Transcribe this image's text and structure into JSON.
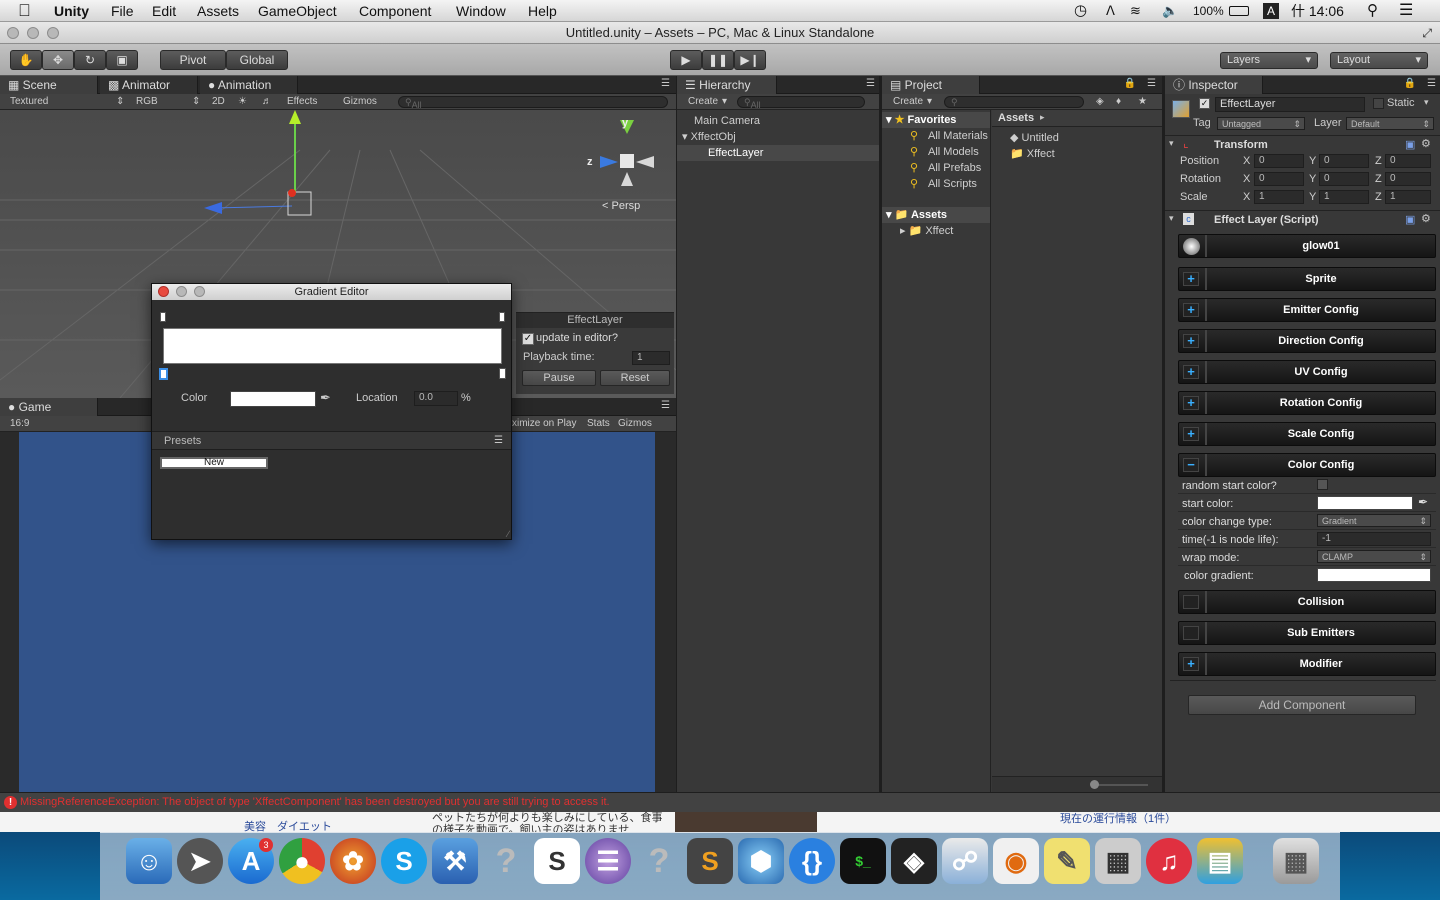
{
  "menubar": {
    "apple": "",
    "items": [
      "Unity",
      "File",
      "Edit",
      "Assets",
      "GameObject",
      "Component",
      "Window",
      "Help"
    ],
    "battery": "100%",
    "input": "A",
    "clock": "什 14:06"
  },
  "window": {
    "title": "Untitled.unity – Assets – PC, Mac & Linux Standalone"
  },
  "toolbar": {
    "pivot": "Pivot",
    "global": "Global",
    "layers": "Layers",
    "layout": "Layout"
  },
  "scene": {
    "tabs": [
      "Scene",
      "Animator",
      "Animation"
    ],
    "shading": "Textured",
    "render": "RGB",
    "mode2d": "2D",
    "effects": "Effects",
    "gizmos": "Gizmos",
    "search": "All",
    "gizmo_y": "y",
    "gizmo_z": "z",
    "persp": "Persp"
  },
  "effect_panel": {
    "title": "EffectLayer",
    "update_label": "update in editor?",
    "playback_label": "Playback time:",
    "playback_value": "1",
    "pause": "Pause",
    "reset": "Reset"
  },
  "gradient_editor": {
    "title": "Gradient Editor",
    "color_label": "Color",
    "location_label": "Location",
    "location_value": "0.0",
    "percent": "%",
    "presets_label": "Presets",
    "new_label": "New"
  },
  "game": {
    "tab": "Game",
    "aspect": "16:9",
    "maximize": "ximize on Play",
    "stats": "Stats",
    "gizmos": "Gizmos"
  },
  "hierarchy": {
    "tab": "Hierarchy",
    "create": "Create",
    "search": "All",
    "items": [
      "Main Camera",
      "XffectObj",
      "EffectLayer"
    ]
  },
  "project": {
    "tab": "Project",
    "create": "Create",
    "favorites": "Favorites",
    "favorite_items": [
      "All Materials",
      "All Models",
      "All Prefabs",
      "All Scripts"
    ],
    "assets": "Assets",
    "asset_tree": [
      "Xffect"
    ],
    "breadcrumb": "Assets",
    "files": [
      "Untitled",
      "Xffect"
    ]
  },
  "inspector": {
    "tab": "Inspector",
    "object_name": "EffectLayer",
    "static": "Static",
    "tag_label": "Tag",
    "tag_value": "Untagged",
    "layer_label": "Layer",
    "layer_value": "Default",
    "transform": "Transform",
    "transform_rows": [
      {
        "label": "Position",
        "x": "0",
        "y": "0",
        "z": "0"
      },
      {
        "label": "Rotation",
        "x": "0",
        "y": "0",
        "z": "0"
      },
      {
        "label": "Scale",
        "x": "1",
        "y": "1",
        "z": "1"
      }
    ],
    "axis_x": "X",
    "axis_y": "Y",
    "axis_z": "Z",
    "script_title": "Effect Layer (Script)",
    "material": "glow01",
    "sections": [
      "Sprite",
      "Emitter Config",
      "Direction Config",
      "UV Config",
      "Rotation Config",
      "Scale Config",
      "Color Config"
    ],
    "color_rows": {
      "random_start": "random start color?",
      "start_color": "start color:",
      "change_type": "color change type:",
      "change_type_value": "Gradient",
      "time": "time(-1 is node life):",
      "time_value": "-1",
      "wrap": "wrap mode:",
      "wrap_value": "CLAMP",
      "gradient": "color gradient:"
    },
    "more_sections": [
      "Collision",
      "Sub Emitters",
      "Modifier"
    ],
    "add_component": "Add Component"
  },
  "console": {
    "message": "MissingReferenceException: The object of type 'XffectComponent' has been destroyed but you are still trying to access it."
  },
  "background_texts": [
    "美容　ダイエット",
    "ペットたちが何よりも楽しみにしている、食事",
    "の様子を動画で。飼い主の姿はありませ",
    "現在の運行情報（1件）"
  ],
  "dock": {
    "badge": "3"
  },
  "colors": {
    "accent": "#3a8ee6",
    "game_bg": "#32538a",
    "error": "#e03030"
  }
}
